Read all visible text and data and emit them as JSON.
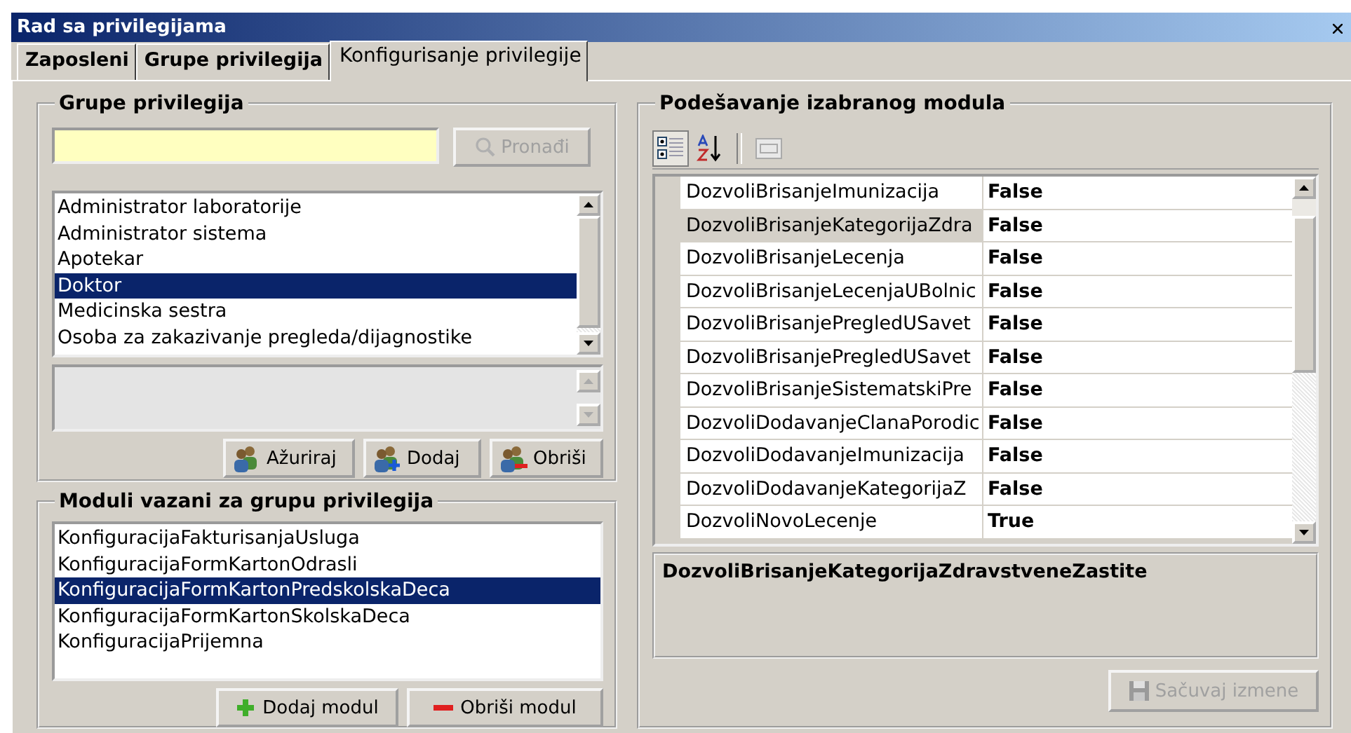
{
  "window": {
    "title": "Rad sa privilegijama"
  },
  "tabs": [
    {
      "label": "Zaposleni",
      "selected": false
    },
    {
      "label": "Grupe privilegija",
      "selected": false
    },
    {
      "label": "Konfigurisanje privilegije",
      "selected": true
    }
  ],
  "groups_panel": {
    "title": "Grupe privilegija",
    "search_button": {
      "label": "Pronađi",
      "disabled": true
    },
    "items": [
      {
        "label": "Administrator laboratorije",
        "selected": false
      },
      {
        "label": "Administrator sistema",
        "selected": false
      },
      {
        "label": "Apotekar",
        "selected": false
      },
      {
        "label": "Doktor",
        "selected": true
      },
      {
        "label": "Medicinska sestra",
        "selected": false
      },
      {
        "label": "Osoba za zakazivanje pregleda/dijagnostike",
        "selected": false
      }
    ],
    "buttons": [
      {
        "label": "Ažuriraj",
        "kind": "edit"
      },
      {
        "label": "Dodaj",
        "kind": "add"
      },
      {
        "label": "Obriši",
        "kind": "delete"
      }
    ]
  },
  "modules_panel": {
    "title": "Moduli vazani za grupu privilegija",
    "items": [
      {
        "label": "KonfiguracijaFakturisanjaUsluga",
        "selected": false
      },
      {
        "label": "KonfiguracijaFormKartonOdrasli",
        "selected": false
      },
      {
        "label": "KonfiguracijaFormKartonPredskolskaDeca",
        "selected": true
      },
      {
        "label": "KonfiguracijaFormKartonSkolskaDeca",
        "selected": false
      },
      {
        "label": "KonfiguracijaPrijemna",
        "selected": false
      }
    ],
    "buttons": [
      {
        "label": "Dodaj modul",
        "kind": "add"
      },
      {
        "label": "Obriši modul",
        "kind": "remove"
      }
    ]
  },
  "settings_panel": {
    "title": "Podešavanje izabranog modula",
    "toolbar": [
      {
        "kind": "categorized",
        "selected": true
      },
      {
        "kind": "alphabetical",
        "selected": false
      },
      {
        "kind": "property_pages",
        "selected": false
      }
    ],
    "properties": [
      {
        "name": "DozvoliBrisanjeImunizacija",
        "value": "False",
        "selected": false
      },
      {
        "name": "DozvoliBrisanjeKategorijaZdra",
        "value": "False",
        "selected": true
      },
      {
        "name": "DozvoliBrisanjeLecenja",
        "value": "False",
        "selected": false
      },
      {
        "name": "DozvoliBrisanjeLecenjaUBolnic",
        "value": "False",
        "selected": false
      },
      {
        "name": "DozvoliBrisanjePregledUSavet",
        "value": "False",
        "selected": false
      },
      {
        "name": "DozvoliBrisanjePregledUSavet",
        "value": "False",
        "selected": false
      },
      {
        "name": "DozvoliBrisanjeSistematskiPre",
        "value": "False",
        "selected": false
      },
      {
        "name": "DozvoliDodavanjeClanaPorodic",
        "value": "False",
        "selected": false
      },
      {
        "name": "DozvoliDodavanjeImunizacija",
        "value": "False",
        "selected": false
      },
      {
        "name": "DozvoliDodavanjeKategorijaZ",
        "value": "False",
        "selected": false
      },
      {
        "name": "DozvoliNovoLecenje",
        "value": "True",
        "selected": false
      }
    ],
    "description": "DozvoliBrisanjeKategorijaZdravstveneZastite",
    "save_button": {
      "label": "Sačuvaj izmene",
      "disabled": true
    }
  }
}
